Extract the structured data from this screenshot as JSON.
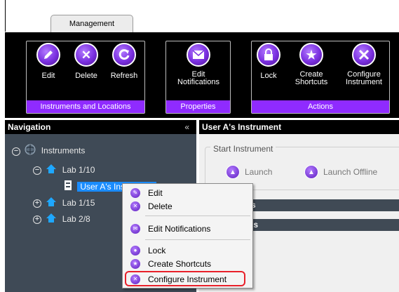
{
  "tabs": {
    "management": "Management"
  },
  "ribbon": {
    "groups": [
      {
        "label": "Instruments and Locations",
        "buttons": [
          {
            "label": "Edit",
            "icon": "pencil-icon"
          },
          {
            "label": "Delete",
            "icon": "x-icon"
          },
          {
            "label": "Refresh",
            "icon": "refresh-icon"
          }
        ]
      },
      {
        "label": "Properties",
        "buttons": [
          {
            "label": "Edit\nNotifications",
            "icon": "envelope-icon"
          }
        ]
      },
      {
        "label": "Actions",
        "buttons": [
          {
            "label": "Lock",
            "icon": "lock-icon"
          },
          {
            "label": "Create\nShortcuts",
            "icon": "star-icon"
          },
          {
            "label": "Configure\nInstrument",
            "icon": "tools-icon"
          }
        ]
      }
    ],
    "accent": "#8f2bff"
  },
  "navigation": {
    "title": "Navigation",
    "collapse": "«",
    "tree": {
      "root": "Instruments",
      "lab1": "Lab 1/10",
      "instrument": "User A's Instrument",
      "lab2": "Lab 1/15",
      "lab3": "Lab 2/8"
    }
  },
  "content": {
    "title": "User A's Instrument",
    "start_group": "Start Instrument",
    "launch": "Launch",
    "launch_offline": "Launch Offline",
    "bar1_suffix": "s",
    "bar2_suffix": "ls"
  },
  "context_menu": {
    "items": [
      {
        "label": "Edit",
        "icon": "pencil-icon"
      },
      {
        "label": "Delete",
        "icon": "x-icon"
      },
      {
        "label": "Edit Notifications",
        "icon": "envelope-icon"
      },
      {
        "label": "Lock",
        "icon": "lock-icon"
      },
      {
        "label": "Create Shortcuts",
        "icon": "star-icon"
      },
      {
        "label": "Configure Instrument",
        "icon": "tools-icon"
      }
    ],
    "highlight_color": "#e8202a"
  }
}
